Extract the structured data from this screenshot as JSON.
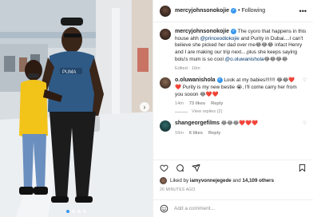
{
  "post": {
    "author": "mercyjohnsonokojie",
    "follow_status": "Following",
    "separator": "•",
    "caption": {
      "author": "mercyjohnsonokojie",
      "text_before": " The cyoro that happens in this house ahh ",
      "mention1": "@princeodiokojie",
      "text_middle": " and Purity in Dubai....I can't believe she picked her dad over me",
      "emojis1": "😂😂😂",
      "text_after": " infact Henry and I are making our trip next....plus she keeps saying bolu's mum is so cool ",
      "mention2": "@o.oluwanishola",
      "emojis2": "😂😂😂😂",
      "edited": "Edited · 16m"
    },
    "comments": [
      {
        "author": "o.oluwanishola",
        "text": " Look at my babies!!!!!!! 😂😂❤️❤️ Purity is my new bestie 😭, I'll come carry her from you sooon 😂❤️❤️",
        "time": "14m",
        "likes": "73 likes",
        "reply": "Reply",
        "view_replies": "View replies (2)"
      },
      {
        "author": "shangeorgefilms",
        "text": " 😂😂😂❤️❤️❤️",
        "time": "16m",
        "likes": "6 likes",
        "reply": "Reply"
      }
    ],
    "liked_by": {
      "prefix": "Liked by ",
      "user": "iamyvonnejegede",
      "middle": " and ",
      "others": "14,109 others"
    },
    "time_ago": "26 MINUTES AGO",
    "comment_placeholder": "Add a comment...",
    "photo": {
      "slide_count": 4,
      "active_slide": 1,
      "shirt_text": "PUMA"
    }
  }
}
